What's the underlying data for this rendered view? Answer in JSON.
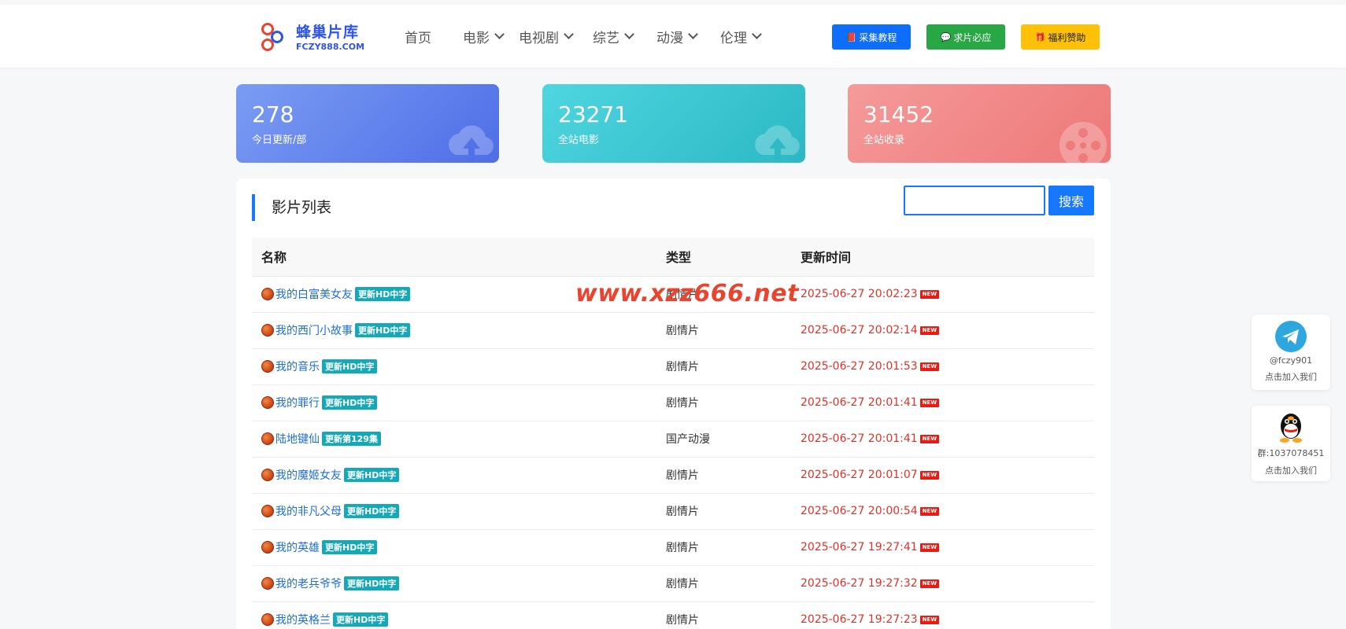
{
  "logo": {
    "cn": "蜂巢片库",
    "en": "FCZY888.COM"
  },
  "nav": [
    {
      "label": "首页",
      "dropdown": false
    },
    {
      "label": "电影",
      "dropdown": true
    },
    {
      "label": "电视剧",
      "dropdown": true
    },
    {
      "label": "综艺",
      "dropdown": true
    },
    {
      "label": "动漫",
      "dropdown": true
    },
    {
      "label": "伦理",
      "dropdown": true
    }
  ],
  "header_buttons": [
    {
      "label": "采集教程",
      "icon": "book-icon",
      "color": "#0d6efd"
    },
    {
      "label": "求片必应",
      "icon": "chat-icon",
      "color": "#28a745"
    },
    {
      "label": "福利赞助",
      "icon": "gift-icon",
      "color": "#ffc107"
    }
  ],
  "stats": [
    {
      "value": "278",
      "label": "今日更新/部",
      "color_from": "#7b9cf3",
      "color_to": "#4e6ee7",
      "icon": "cloud-upload-icon"
    },
    {
      "value": "23271",
      "label": "全站电影",
      "color_from": "#4fd6e0",
      "color_to": "#2bb8c4",
      "icon": "cloud-upload-icon"
    },
    {
      "value": "31452",
      "label": "全站收录",
      "color_from": "#f59a9a",
      "color_to": "#ee7878",
      "icon": "film-reel-icon"
    }
  ],
  "list": {
    "title": "影片列表",
    "search_button": "搜索",
    "search_value": "",
    "columns": [
      "名称",
      "类型",
      "更新时间"
    ],
    "rows": [
      {
        "name": "我的白富美女友",
        "tag": "更新HD中字",
        "type": "剧情片",
        "time": "2025-06-27 20:02:23"
      },
      {
        "name": "我的西门小故事",
        "tag": "更新HD中字",
        "type": "剧情片",
        "time": "2025-06-27 20:02:14"
      },
      {
        "name": "我的音乐",
        "tag": "更新HD中字",
        "type": "剧情片",
        "time": "2025-06-27 20:01:53"
      },
      {
        "name": "我的罪行",
        "tag": "更新HD中字",
        "type": "剧情片",
        "time": "2025-06-27 20:01:41"
      },
      {
        "name": "陆地键仙",
        "tag": "更新第129集",
        "type": "国产动漫",
        "time": "2025-06-27 20:01:41"
      },
      {
        "name": "我的魔姬女友",
        "tag": "更新HD中字",
        "type": "剧情片",
        "time": "2025-06-27 20:01:07"
      },
      {
        "name": "我的非凡父母",
        "tag": "更新HD中字",
        "type": "剧情片",
        "time": "2025-06-27 20:00:54"
      },
      {
        "name": "我的英雄",
        "tag": "更新HD中字",
        "type": "剧情片",
        "time": "2025-06-27 19:27:41"
      },
      {
        "name": "我的老兵爷爷",
        "tag": "更新HD中字",
        "type": "剧情片",
        "time": "2025-06-27 19:27:32"
      },
      {
        "name": "我的英格兰",
        "tag": "更新HD中字",
        "type": "剧情片",
        "time": "2025-06-27 19:27:23"
      }
    ],
    "new_badge": "NEW"
  },
  "watermark": "www.xzz666.net",
  "side": [
    {
      "icon": "telegram-icon",
      "line1": "@fczy901",
      "line2": "点击加入我们"
    },
    {
      "icon": "qq-icon",
      "line1": "群:1037078451",
      "line2": "点击加入我们"
    }
  ]
}
